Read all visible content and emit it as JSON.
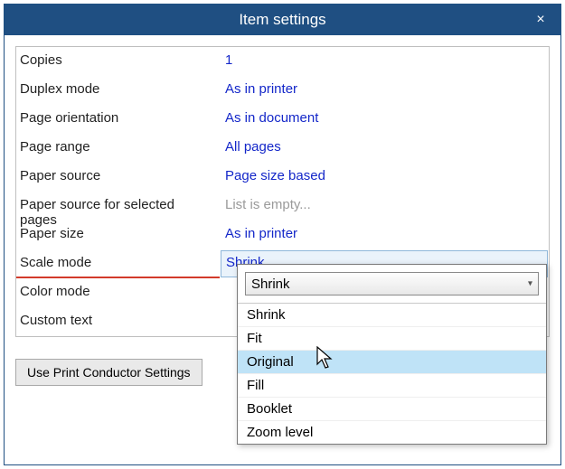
{
  "title": "Item settings",
  "close_glyph": "×",
  "rows": [
    {
      "label": "Copies",
      "value": "1",
      "empty": false
    },
    {
      "label": "Duplex mode",
      "value": "As in printer",
      "empty": false
    },
    {
      "label": "Page orientation",
      "value": "As in document",
      "empty": false
    },
    {
      "label": "Page range",
      "value": "All pages",
      "empty": false
    },
    {
      "label": "Paper source",
      "value": "Page size based",
      "empty": false
    },
    {
      "label": "Paper source for selected pages",
      "value": "List is empty...",
      "empty": true
    },
    {
      "label": "Paper size",
      "value": "As in printer",
      "empty": false
    },
    {
      "label": "Scale mode",
      "value": "Shrink",
      "empty": false,
      "selected": true
    },
    {
      "label": "Color mode",
      "value": "",
      "empty": false
    },
    {
      "label": "Custom text",
      "value": "",
      "empty": false
    }
  ],
  "footer": {
    "use_defaults": "Use Print Conductor Settings"
  },
  "dropdown": {
    "current": "Shrink",
    "options": [
      "Shrink",
      "Fit",
      "Original",
      "Fill",
      "Booklet",
      "Zoom level"
    ],
    "highlight_index": 2
  }
}
